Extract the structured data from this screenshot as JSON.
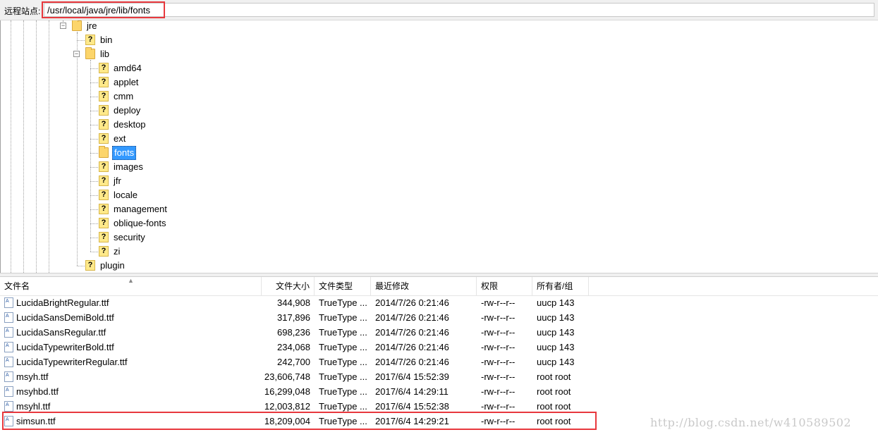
{
  "remote_site": {
    "label": "远程站点:",
    "path": "/usr/local/java/jre/lib/fonts"
  },
  "tree": {
    "root": "jre",
    "jre_children": [
      "bin",
      "lib",
      "plugin"
    ],
    "lib_children": [
      "amd64",
      "applet",
      "cmm",
      "deploy",
      "desktop",
      "ext",
      "fonts",
      "images",
      "jfr",
      "locale",
      "management",
      "oblique-fonts",
      "security",
      "zi"
    ],
    "selected": "fonts"
  },
  "file_list": {
    "columns": [
      "文件名",
      "文件大小",
      "文件类型",
      "最近修改",
      "权限",
      "所有者/组"
    ],
    "rows": [
      {
        "name": "LucidaBrightRegular.ttf",
        "size": "344,908",
        "type": "TrueType ...",
        "modified": "2014/7/26 0:21:46",
        "perms": "-rw-r--r--",
        "owner": "uucp 143"
      },
      {
        "name": "LucidaSansDemiBold.ttf",
        "size": "317,896",
        "type": "TrueType ...",
        "modified": "2014/7/26 0:21:46",
        "perms": "-rw-r--r--",
        "owner": "uucp 143"
      },
      {
        "name": "LucidaSansRegular.ttf",
        "size": "698,236",
        "type": "TrueType ...",
        "modified": "2014/7/26 0:21:46",
        "perms": "-rw-r--r--",
        "owner": "uucp 143"
      },
      {
        "name": "LucidaTypewriterBold.ttf",
        "size": "234,068",
        "type": "TrueType ...",
        "modified": "2014/7/26 0:21:46",
        "perms": "-rw-r--r--",
        "owner": "uucp 143"
      },
      {
        "name": "LucidaTypewriterRegular.ttf",
        "size": "242,700",
        "type": "TrueType ...",
        "modified": "2014/7/26 0:21:46",
        "perms": "-rw-r--r--",
        "owner": "uucp 143"
      },
      {
        "name": "msyh.ttf",
        "size": "23,606,748",
        "type": "TrueType ...",
        "modified": "2017/6/4 15:52:39",
        "perms": "-rw-r--r--",
        "owner": "root root"
      },
      {
        "name": "msyhbd.ttf",
        "size": "16,299,048",
        "type": "TrueType ...",
        "modified": "2017/6/4 14:29:11",
        "perms": "-rw-r--r--",
        "owner": "root root"
      },
      {
        "name": "msyhl.ttf",
        "size": "12,003,812",
        "type": "TrueType ...",
        "modified": "2017/6/4 15:52:38",
        "perms": "-rw-r--r--",
        "owner": "root root"
      },
      {
        "name": "simsun.ttf",
        "size": "18,209,004",
        "type": "TrueType ...",
        "modified": "2017/6/4 14:29:21",
        "perms": "-rw-r--r--",
        "owner": "root root"
      }
    ]
  },
  "watermark": "http://blog.csdn.net/w410589502",
  "colors": {
    "highlight_box": "#e8383d",
    "selection": "#3399ff"
  },
  "icons": {
    "unknown_folder": "question-folder-icon",
    "folder": "folder-icon",
    "font_file": "font-file-icon"
  }
}
